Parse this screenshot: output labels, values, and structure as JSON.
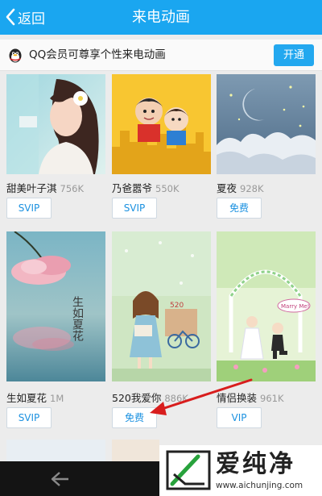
{
  "header": {
    "back_label": "返回",
    "title": "来电动画"
  },
  "banner": {
    "text": "QQ会员可尊享个性来电动画",
    "button_label": "开通"
  },
  "cards": [
    {
      "title": "甜美叶子淇",
      "size": "756K",
      "badge": "SVIP"
    },
    {
      "title": "乃爸嚣爷",
      "size": "550K",
      "badge": "SVIP"
    },
    {
      "title": "夏夜",
      "size": "928K",
      "badge": "免费"
    },
    {
      "title": "生如夏花",
      "size": "1M",
      "badge": "SVIP"
    },
    {
      "title": "520我爱你",
      "size": "886K",
      "badge": "免费"
    },
    {
      "title": "情侣换装",
      "size": "961K",
      "badge": "VIP"
    }
  ],
  "card_art": {
    "3": {
      "caption": "生如夏花"
    },
    "4": {
      "caption": "520"
    },
    "5": {
      "caption": "Marry Me!"
    }
  },
  "watermark": {
    "text": "爱纯净",
    "url": "www.aichunjing.com"
  },
  "colors": {
    "header_bg": "#1aa6f0",
    "button_bg": "#23a8ef",
    "pill_text": "#1b91e0",
    "arrow": "#d81d1d"
  },
  "icons": {
    "back": "chevron-left-icon",
    "qq": "qq-penguin-icon",
    "nav": "arrow-left-icon"
  }
}
